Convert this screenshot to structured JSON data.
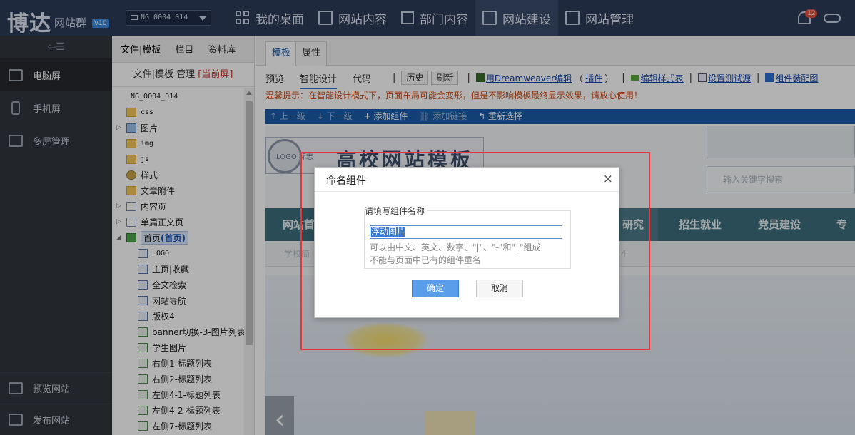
{
  "topbar": {
    "logo": "博达",
    "logo_sub": "网站群",
    "version": "V10",
    "site_select": "NG_0004_014",
    "nav": [
      {
        "label": "我的桌面",
        "icon": "grid-icon"
      },
      {
        "label": "网站内容",
        "icon": "edit-icon"
      },
      {
        "label": "部门内容",
        "icon": "org-tree-icon"
      },
      {
        "label": "网站建设",
        "icon": "build-icon",
        "active": true
      },
      {
        "label": "网站管理",
        "icon": "monitor-settings-icon"
      }
    ],
    "notification_count": "12"
  },
  "sidebar": {
    "collapse_icon": "collapse-menu-icon",
    "items": [
      {
        "label": "电脑屏",
        "icon": "monitor-icon",
        "active": true
      },
      {
        "label": "手机屏",
        "icon": "phone-icon"
      },
      {
        "label": "多屏管理",
        "icon": "multi-screen-icon"
      }
    ],
    "bottom_items": [
      {
        "label": "预览网站",
        "icon": "preview-icon"
      },
      {
        "label": "发布网站",
        "icon": "publish-icon"
      }
    ]
  },
  "filepanel": {
    "tabs": [
      "文件|模板",
      "栏目",
      "资料库"
    ],
    "header": "文件|模板 管理",
    "header_current": "[当前屏]",
    "tree": [
      {
        "label": "NG_0004_014",
        "icon": "monitor",
        "level": 0,
        "mono": true
      },
      {
        "label": "css",
        "icon": "folder",
        "level": 1,
        "mono": true
      },
      {
        "label": "图片",
        "icon": "img",
        "level": 1,
        "arrow": "▷"
      },
      {
        "label": "img",
        "icon": "folder",
        "level": 1,
        "mono": true
      },
      {
        "label": "js",
        "icon": "folder",
        "level": 1,
        "mono": true
      },
      {
        "label": "样式",
        "icon": "gear",
        "level": 1
      },
      {
        "label": "文章附件",
        "icon": "folder",
        "level": 1
      },
      {
        "label": "内容页",
        "icon": "page",
        "level": 1,
        "arrow": "▷"
      },
      {
        "label": "单篇正文页",
        "icon": "page",
        "level": 1,
        "arrow": "▷"
      },
      {
        "label": "首页",
        "suffix": "(首页)",
        "icon": "home",
        "level": 1,
        "arrow": "◢",
        "selected": true
      },
      {
        "label": "LOGO",
        "icon": "comp",
        "level": 2,
        "mono": true
      },
      {
        "label": "主页|收藏",
        "icon": "comp",
        "level": 2
      },
      {
        "label": "全文检索",
        "icon": "comp",
        "level": 2
      },
      {
        "label": "网站导航",
        "icon": "comp",
        "level": 2
      },
      {
        "label": "版权4",
        "icon": "comp",
        "level": 2
      },
      {
        "label": "banner切换-3-图片列表",
        "icon": "list",
        "level": 2
      },
      {
        "label": "学生图片",
        "icon": "list",
        "level": 2
      },
      {
        "label": "右侧1-标题列表",
        "icon": "list",
        "level": 2
      },
      {
        "label": "右侧2-标题列表",
        "icon": "list",
        "level": 2
      },
      {
        "label": "左侧4-1-标题列表",
        "icon": "list",
        "level": 2
      },
      {
        "label": "左侧4-2-标题列表",
        "icon": "list",
        "level": 2
      },
      {
        "label": "左侧7-标题列表",
        "icon": "list",
        "level": 2
      }
    ]
  },
  "main": {
    "tabs": [
      "模板",
      "属性"
    ],
    "toolbar": {
      "preview": "预览",
      "smart_design": "智能设计",
      "code": "代码",
      "history": "历史",
      "refresh": "刷新",
      "dreamweaver": "用Dreamweaver编辑",
      "plugin_open": "（",
      "plugin": "插件",
      "plugin_close": "）",
      "edit_style": "编辑样式表",
      "test_source": "设置测试源",
      "component_map": "组件装配图"
    },
    "tip": "温馨提示：在智能设计模式下，页面布局可能会变形，但是不影响模板最终显示效果，请放心使用！",
    "bluebar": {
      "up": "上一级",
      "down": "下一级",
      "add": "添加组件",
      "add_link": "添加链接",
      "reselect": "重新选择"
    },
    "canvas": {
      "site_name": "高校网站模板包",
      "seal_text": "LOGO 标志",
      "search_placeholder": "输入关键字搜索",
      "nav_left": "网站首",
      "nav_hl": "研究",
      "nav_items": [
        "招生就业",
        "党员建设",
        "专题"
      ],
      "sub_left": "学校简",
      "sub_right": "4"
    }
  },
  "dialog": {
    "title": "命名组件",
    "legend": "请填写组件名称",
    "input_value": "浮动图片",
    "hint1": "可以由中文、英文、数字、\"|\"、\"-\"和\"_\"组成",
    "hint2": "不能与页面中已有的组件重名",
    "ok": "确定",
    "cancel": "取消"
  },
  "colors": {
    "topbar_bg": "#2b3b59",
    "sidebar_bg": "#31353c",
    "accent_blue": "#1a5ca8",
    "highlight_red": "#e8353a",
    "tip_orange": "#d04a14",
    "ok_button": "#5a9ee9"
  }
}
